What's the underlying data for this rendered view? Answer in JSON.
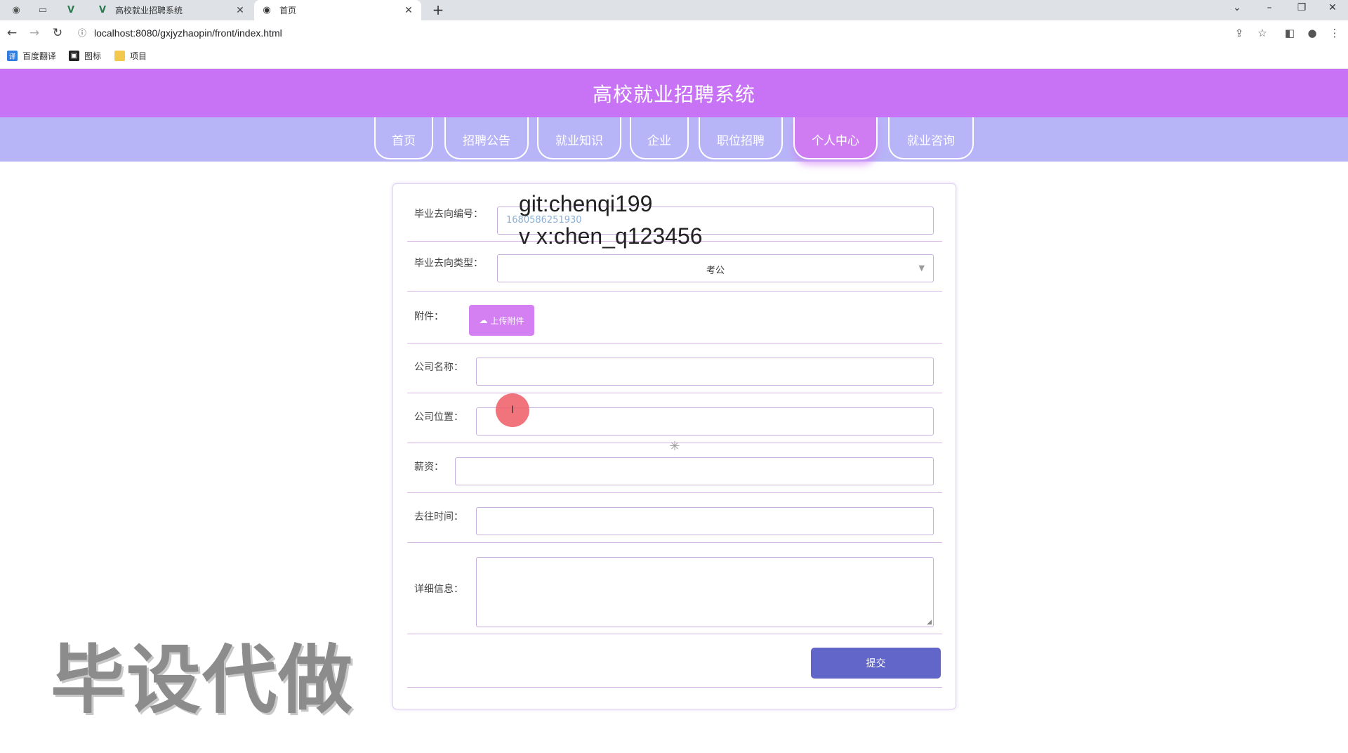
{
  "browser": {
    "tabs": [
      {
        "title": "高校就业招聘系统",
        "close": "✕"
      },
      {
        "title": "首页",
        "close": "✕"
      }
    ],
    "new_tab": "+",
    "url": "localhost:8080/gxjyzhaopin/front/index.html",
    "bookmarks": [
      "百度翻译",
      "图标",
      "项目"
    ]
  },
  "site": {
    "title": "高校就业招聘系统",
    "nav": [
      "首页",
      "招聘公告",
      "就业知识",
      "企业",
      "职位招聘",
      "个人中心",
      "就业咨询"
    ],
    "active_nav": "个人中心"
  },
  "form": {
    "fields": {
      "id_label": "毕业去向编号：",
      "id_value": "1680586251930",
      "type_label": "毕业去向类型：",
      "type_value": "考公",
      "attachment_label": "附件：",
      "upload_label": "上传附件",
      "company_label": "公司名称：",
      "location_label": "公司位置：",
      "salary_label": "薪资：",
      "date_label": "去往时间：",
      "details_label": "详细信息："
    },
    "submit_label": "提交"
  },
  "overlays": {
    "git": "git:chenqi199",
    "vx": "v x:chen_q123456",
    "watermark": "毕设代做"
  },
  "colors": {
    "header": "#c873f5",
    "navbar": "#b8b4f8",
    "nav_active": "#cf7cf3",
    "upload_button": "#d47ff2",
    "submit_button": "#6266c9"
  }
}
